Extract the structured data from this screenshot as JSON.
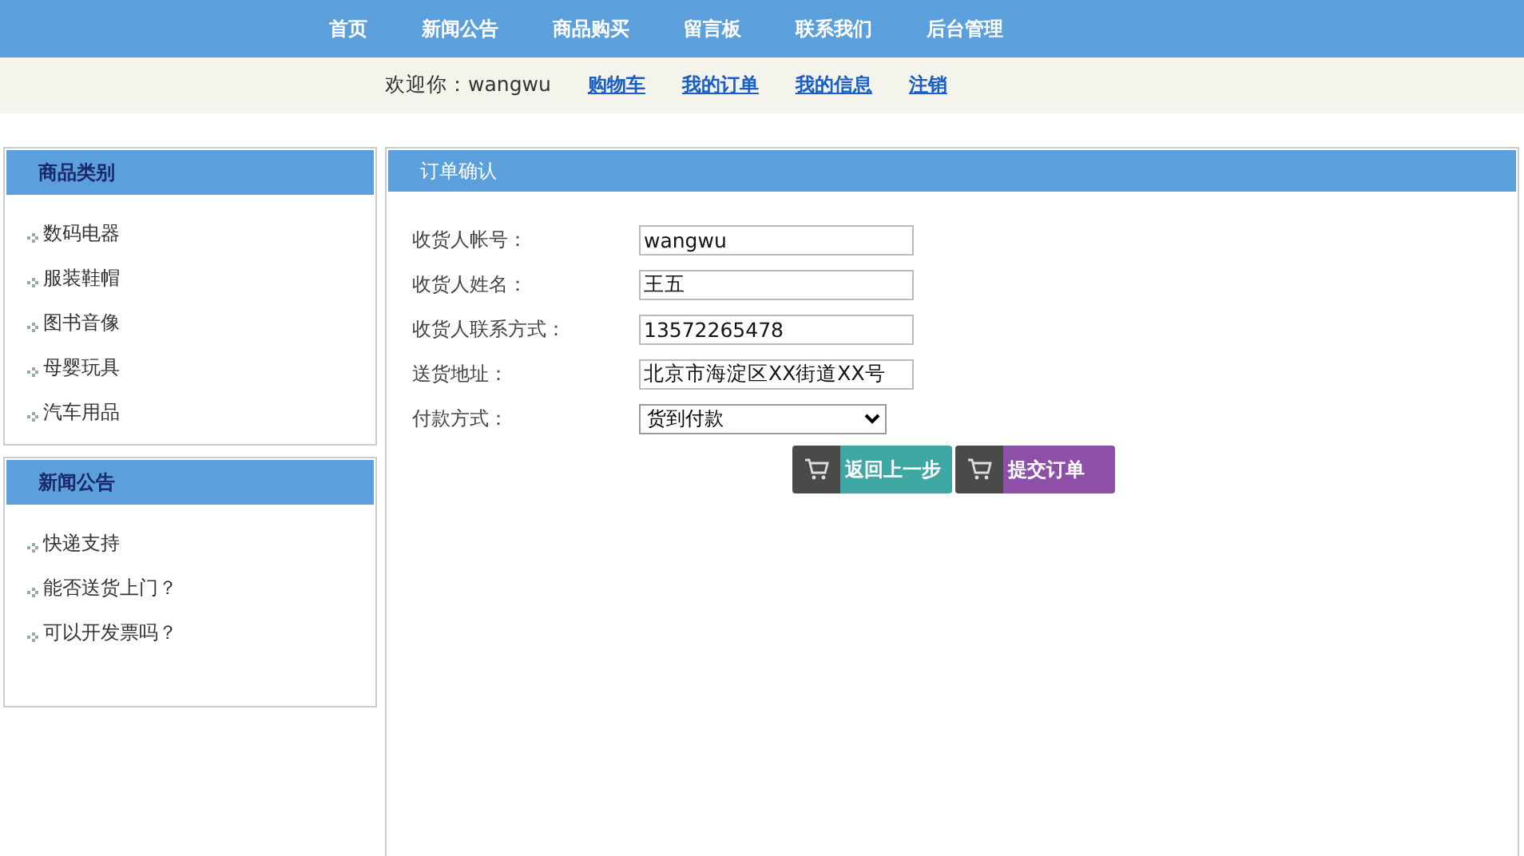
{
  "nav": {
    "items": [
      {
        "label": "首页"
      },
      {
        "label": "新闻公告"
      },
      {
        "label": "商品购买"
      },
      {
        "label": "留言板"
      },
      {
        "label": "联系我们"
      },
      {
        "label": "后台管理"
      }
    ]
  },
  "user_bar": {
    "welcome": "欢迎你：wangwu",
    "links": [
      {
        "label": "购物车"
      },
      {
        "label": "我的订单"
      },
      {
        "label": "我的信息"
      },
      {
        "label": "注销"
      }
    ]
  },
  "sidebar": [
    {
      "title": "商品类别",
      "items": [
        "数码电器",
        "服装鞋帽",
        "图书音像",
        "母婴玩具",
        "汽车用品"
      ]
    },
    {
      "title": "新闻公告",
      "items": [
        "快递支持",
        "能否送货上门？",
        "可以开发票吗？"
      ]
    }
  ],
  "order": {
    "title": "订单确认",
    "fields": [
      {
        "kind": "text",
        "label": "收货人帐号：",
        "value": "wangwu"
      },
      {
        "kind": "text",
        "label": "收货人姓名：",
        "value": "王五"
      },
      {
        "kind": "text",
        "label": "收货人联系方式：",
        "value": "13572265478"
      },
      {
        "kind": "text",
        "label": "送货地址：",
        "value": "北京市海淀区XX街道XX号"
      },
      {
        "kind": "select",
        "label": "付款方式：",
        "value": "货到付款"
      }
    ],
    "buttons": [
      {
        "label": "返回上一步",
        "color": "#3fa8a4"
      },
      {
        "label": "提交订单",
        "color": "#8e4fa8"
      }
    ]
  }
}
